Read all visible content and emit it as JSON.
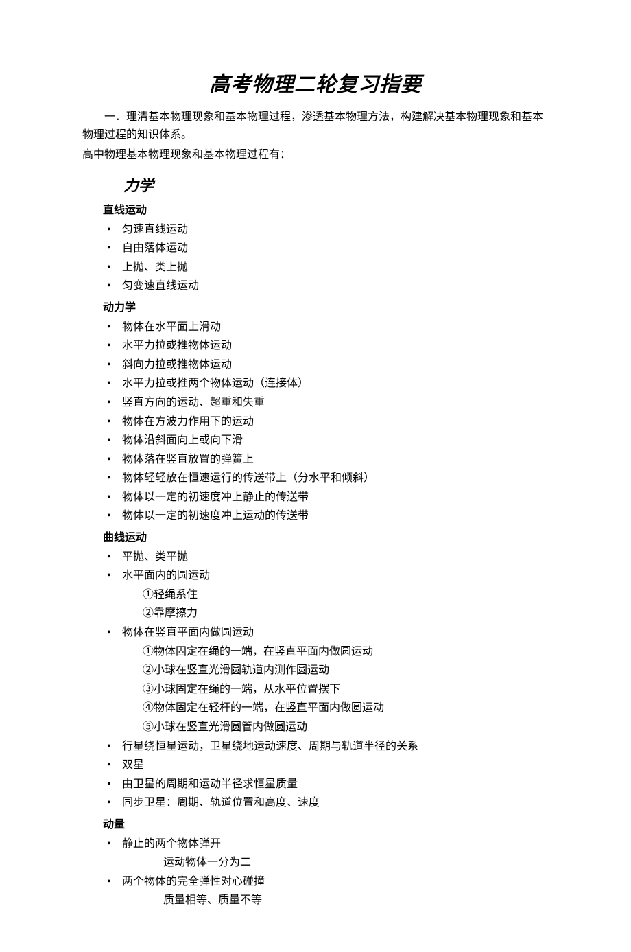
{
  "title": "高考物理二轮复习指要",
  "intro1": "一．理清基本物理现象和基本物理过程，渗透基本物理方法，构建解决基本物理现象和基本物理过程的知识体系。",
  "intro2": "高中物理基本物理现象和基本物理过程有：",
  "sectionHeader": "力学",
  "groups": [
    {
      "heading": "直线运动",
      "items": [
        {
          "text": "匀速直线运动"
        },
        {
          "text": "自由落体运动"
        },
        {
          "text": "上抛、类上抛"
        },
        {
          "text": "匀变速直线运动"
        }
      ]
    },
    {
      "heading": "动力学",
      "items": [
        {
          "text": "物体在水平面上滑动"
        },
        {
          "text": "水平力拉或推物体运动"
        },
        {
          "text": "斜向力拉或推物体运动"
        },
        {
          "text": "水平力拉或推两个物体运动（连接体）"
        },
        {
          "text": "竖直方向的运动、超重和失重"
        },
        {
          "text": "物体在方波力作用下的运动"
        },
        {
          "text": "物体沿斜面向上或向下滑"
        },
        {
          "text": "物体落在竖直放置的弹簧上"
        },
        {
          "text": "物体轻轻放在恒速运行的传送带上（分水平和倾斜）"
        },
        {
          "text": "物体以一定的初速度冲上静止的传送带"
        },
        {
          "text": "物体以一定的初速度冲上运动的传送带"
        }
      ]
    },
    {
      "heading": "曲线运动",
      "items": [
        {
          "text": "平抛、类平抛"
        },
        {
          "text": "水平面内的圆运动",
          "sublines": [
            "①轻绳系住",
            "②靠摩擦力"
          ]
        },
        {
          "text": "物体在竖直平面内做圆运动",
          "sublines": [
            "①物体固定在绳的一端，在竖直平面内做圆运动",
            "②小球在竖直光滑圆轨道内测作圆运动",
            "③小球固定在绳的一端，从水平位置摆下",
            "④物体固定在轻杆的一端，在竖直平面内做圆运动",
            "⑤小球在竖直光滑圆管内做圆运动"
          ]
        },
        {
          "text": "行星绕恒星运动，卫星绕地运动速度、周期与轨道半径的关系"
        },
        {
          "text": "双星"
        },
        {
          "text": "由卫星的周期和运动半径求恒星质量"
        },
        {
          "text": "同步卫星：周期、轨道位置和高度、速度"
        }
      ]
    },
    {
      "heading": "动量",
      "items": [
        {
          "text": "静止的两个物体弹开",
          "sublinesDeep": [
            "运动物体一分为二"
          ]
        },
        {
          "text": "两个物体的完全弹性对心碰撞",
          "sublinesDeep": [
            "质量相等、质量不等"
          ]
        }
      ]
    }
  ]
}
